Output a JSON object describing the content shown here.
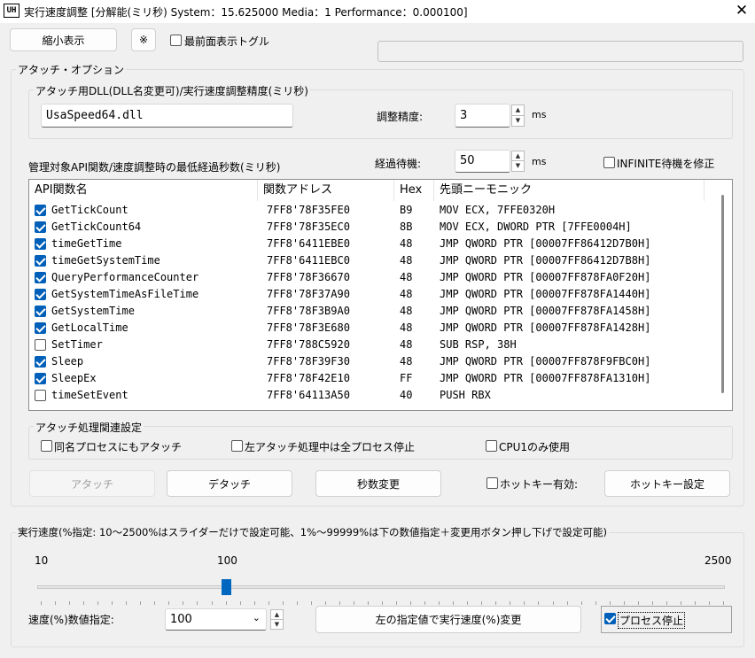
{
  "window": {
    "title": "実行速度調整 [分解能(ミリ秒)  System：15.625000   Media：1   Performance：0.000100]",
    "icon": "UH",
    "close": "✕"
  },
  "top": {
    "shrink_button": "縮小表示",
    "note_button": "※",
    "topmost_label": "最前面表示トグル",
    "topmost_checked": false
  },
  "attach_options": {
    "legend": "アタッチ・オプション",
    "dll_legend": "アタッチ用DLL(DLL名変更可)/実行速度調整精度(ミリ秒)",
    "dll_value": "UsaSpeed64.dll",
    "precision_label": "調整精度:",
    "precision_value": "3",
    "precision_unit": "ms",
    "api_label": "管理対象API関数/速度調整時の最低経過秒数(ミリ秒)",
    "wait_label": "経過待機:",
    "wait_value": "50",
    "wait_unit": "ms",
    "infinite_label": "INFINITE待機を修正",
    "infinite_checked": false
  },
  "api_list": {
    "columns": [
      "API関数名",
      "関数アドレス",
      "Hex",
      "先頭ニーモニック"
    ],
    "rows": [
      {
        "checked": true,
        "name": "GetTickCount",
        "addr": "7FF8'78F35FE0",
        "hex": "B9",
        "mnemonic": "MOV ECX, 7FFE0320H"
      },
      {
        "checked": true,
        "name": "GetTickCount64",
        "addr": "7FF8'78F35EC0",
        "hex": "8B",
        "mnemonic": "MOV ECX, DWORD PTR [7FFE0004H]"
      },
      {
        "checked": true,
        "name": "timeGetTime",
        "addr": "7FF8'6411EBE0",
        "hex": "48",
        "mnemonic": "JMP QWORD PTR [00007FF86412D7B0H]"
      },
      {
        "checked": true,
        "name": "timeGetSystemTime",
        "addr": "7FF8'6411EBC0",
        "hex": "48",
        "mnemonic": "JMP QWORD PTR [00007FF86412D7B8H]"
      },
      {
        "checked": true,
        "name": "QueryPerformanceCounter",
        "addr": "7FF8'78F36670",
        "hex": "48",
        "mnemonic": "JMP QWORD PTR [00007FF878FA0F20H]"
      },
      {
        "checked": true,
        "name": "GetSystemTimeAsFileTime",
        "addr": "7FF8'78F37A90",
        "hex": "48",
        "mnemonic": "JMP QWORD PTR [00007FF878FA1440H]"
      },
      {
        "checked": true,
        "name": "GetSystemTime",
        "addr": "7FF8'78F3B9A0",
        "hex": "48",
        "mnemonic": "JMP QWORD PTR [00007FF878FA1458H]"
      },
      {
        "checked": true,
        "name": "GetLocalTime",
        "addr": "7FF8'78F3E680",
        "hex": "48",
        "mnemonic": "JMP QWORD PTR [00007FF878FA1428H]"
      },
      {
        "checked": false,
        "name": "SetTimer",
        "addr": "7FF8'788C5920",
        "hex": "48",
        "mnemonic": "SUB RSP, 38H"
      },
      {
        "checked": true,
        "name": "Sleep",
        "addr": "7FF8'78F39F30",
        "hex": "48",
        "mnemonic": "JMP QWORD PTR [00007FF878F9FBC0H]"
      },
      {
        "checked": true,
        "name": "SleepEx",
        "addr": "7FF8'78F42E10",
        "hex": "FF",
        "mnemonic": "JMP QWORD PTR [00007FF878FA1310H]"
      },
      {
        "checked": false,
        "name": "timeSetEvent",
        "addr": "7FF8'64113A50",
        "hex": "40",
        "mnemonic": "PUSH RBX"
      }
    ]
  },
  "attach_settings": {
    "legend": "アタッチ処理関連設定",
    "same_name_label": "同名プロセスにもアタッチ",
    "stop_all_label": "左アタッチ処理中は全プロセス停止",
    "cpu1_label": "CPU1のみ使用"
  },
  "actions": {
    "attach": "アタッチ",
    "detach": "デタッチ",
    "change_seconds": "秒数変更",
    "hotkey_enable": "ホットキー有効:",
    "hotkey_settings": "ホットキー設定"
  },
  "speed": {
    "legend": "実行速度(%指定: 10〜2500%はスライダーだけで設定可能、1%〜99999%は下の数値指定＋変更用ボタン押し下げで設定可能)",
    "scale_min": "10",
    "scale_mid": "100",
    "scale_max": "2500",
    "slider_value": 100,
    "value_label": "速度(%)数値指定:",
    "value": "100",
    "apply_button": "左の指定値で実行速度(%)変更",
    "process_stop_label": "プロセス停止",
    "process_stop_checked": true
  },
  "colors": {
    "accent": "#005fb8",
    "slider": "#0067c0"
  }
}
